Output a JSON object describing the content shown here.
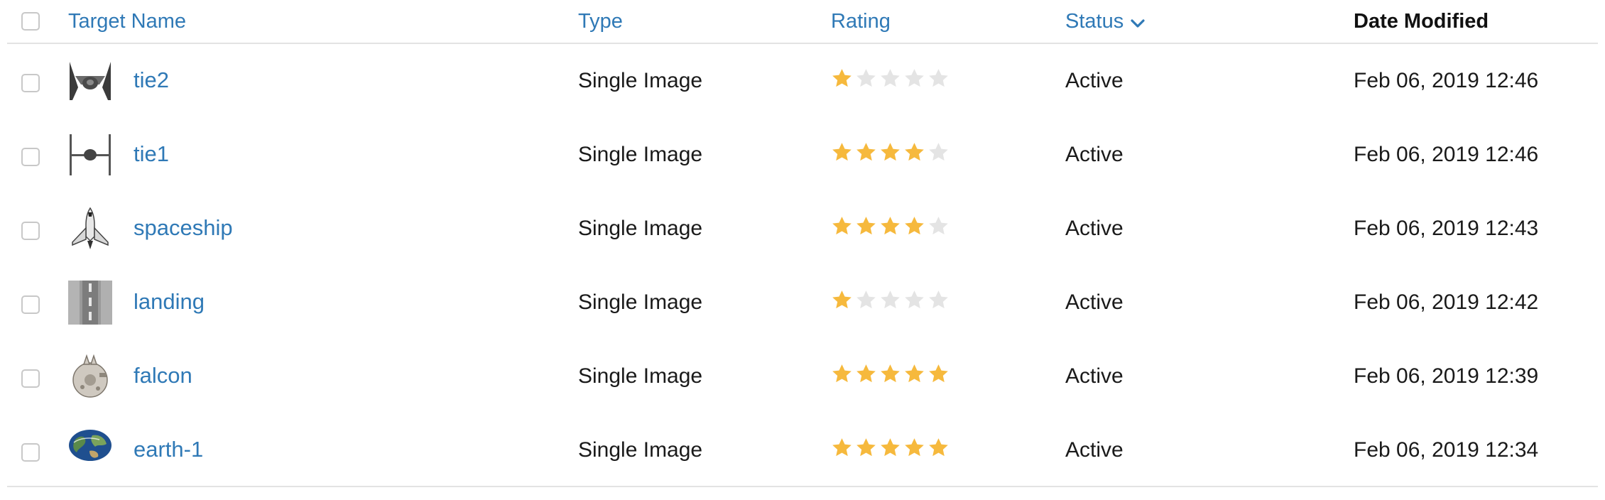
{
  "table": {
    "headers": {
      "name": "Target Name",
      "type": "Type",
      "rating": "Rating",
      "status": "Status",
      "date": "Date Modified"
    },
    "sort": {
      "column": "status",
      "direction": "descending",
      "icon": "chevron-down-icon"
    },
    "colors": {
      "link": "#2f79b6",
      "star_on": "#f6b93d",
      "star_off": "#e4e4e4"
    },
    "rows": [
      {
        "name": "tie2",
        "thumbnail": "tie-fighter-wings-icon",
        "type": "Single Image",
        "rating": 1,
        "status": "Active",
        "date": "Feb 06, 2019 12:46"
      },
      {
        "name": "tie1",
        "thumbnail": "tie-fighter-side-icon",
        "type": "Single Image",
        "rating": 4,
        "status": "Active",
        "date": "Feb 06, 2019 12:46"
      },
      {
        "name": "spaceship",
        "thumbnail": "space-shuttle-icon",
        "type": "Single Image",
        "rating": 4,
        "status": "Active",
        "date": "Feb 06, 2019 12:43"
      },
      {
        "name": "landing",
        "thumbnail": "runway-texture-icon",
        "type": "Single Image",
        "rating": 1,
        "status": "Active",
        "date": "Feb 06, 2019 12:42"
      },
      {
        "name": "falcon",
        "thumbnail": "millennium-falcon-icon",
        "type": "Single Image",
        "rating": 5,
        "status": "Active",
        "date": "Feb 06, 2019 12:39"
      },
      {
        "name": "earth-1",
        "thumbnail": "earth-globe-icon",
        "type": "Single Image",
        "rating": 5,
        "status": "Active",
        "date": "Feb 06, 2019 12:34"
      }
    ],
    "max_rating": 5
  }
}
